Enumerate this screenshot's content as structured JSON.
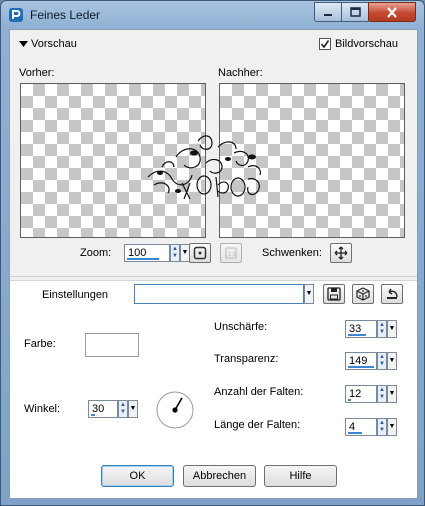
{
  "window": {
    "title": "Feines Leder"
  },
  "preview": {
    "section_label": "Vorschau",
    "bildvorschau_label": "Bildvorschau",
    "bildvorschau_checked": true,
    "before_label": "Vorher:",
    "after_label": "Nachher:",
    "zoom_label": "Zoom:",
    "zoom_value": "100",
    "pan_label": "Schwenken:"
  },
  "settings": {
    "label": "Einstellungen",
    "preset_value": ""
  },
  "params": {
    "color_label": "Farbe:",
    "color_value": "#ffffff",
    "angle_label": "Winkel:",
    "angle_value": "30",
    "blur_label": "Unschärfe:",
    "blur_value": "33",
    "transparency_label": "Transparenz:",
    "transparency_value": "149",
    "folds_label": "Anzahl der Falten:",
    "folds_value": "12",
    "fold_length_label": "Länge der Falten:",
    "fold_length_value": "4"
  },
  "buttons": {
    "ok": "OK",
    "cancel": "Abbrechen",
    "help": "Hilfe"
  }
}
